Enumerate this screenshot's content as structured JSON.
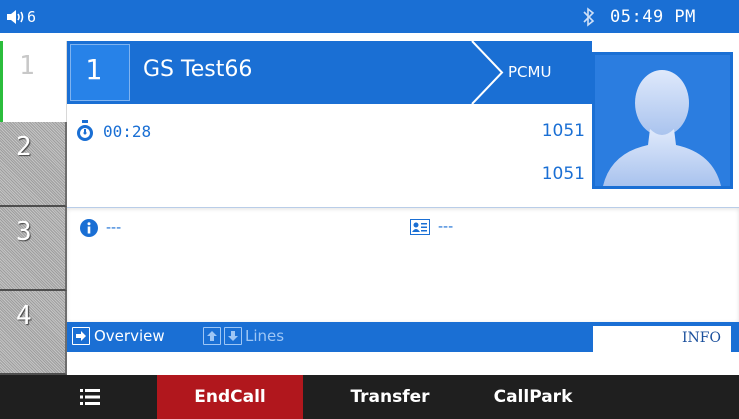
{
  "status_bar": {
    "volume_icon": "speaker-icon",
    "volume_level": "6",
    "bluetooth_icon": "bluetooth-icon",
    "time": "05:49 PM",
    "background": "#1a6fd4"
  },
  "line_tabs": [
    {
      "label": "1",
      "active": true
    },
    {
      "label": "2",
      "active": false
    },
    {
      "label": "3",
      "active": false
    },
    {
      "label": "4",
      "active": false
    }
  ],
  "call": {
    "line_index": "1",
    "contact_name": "GS Test66",
    "codec": "PCMU",
    "timer_icon": "stopwatch-icon",
    "duration": "00:28",
    "number_1": "1051",
    "number_2": "1051",
    "avatar_icon": "contact-avatar-icon"
  },
  "info_panel": {
    "info_icon": "info-icon",
    "info_value": "---",
    "card_icon": "contact-card-icon",
    "card_value": "---"
  },
  "overview_bar": {
    "overview_icon": "arrow-right-icon",
    "overview_label": "Overview",
    "up_icon": "arrow-up-icon",
    "down_icon": "arrow-down-icon",
    "lines_label": "Lines",
    "info_tab": "INFO"
  },
  "softkeys": {
    "menu_icon": "menu-icon",
    "endcall": "EndCall",
    "transfer": "Transfer",
    "callpark": "CallPark",
    "endcall_color": "#b1171d"
  }
}
